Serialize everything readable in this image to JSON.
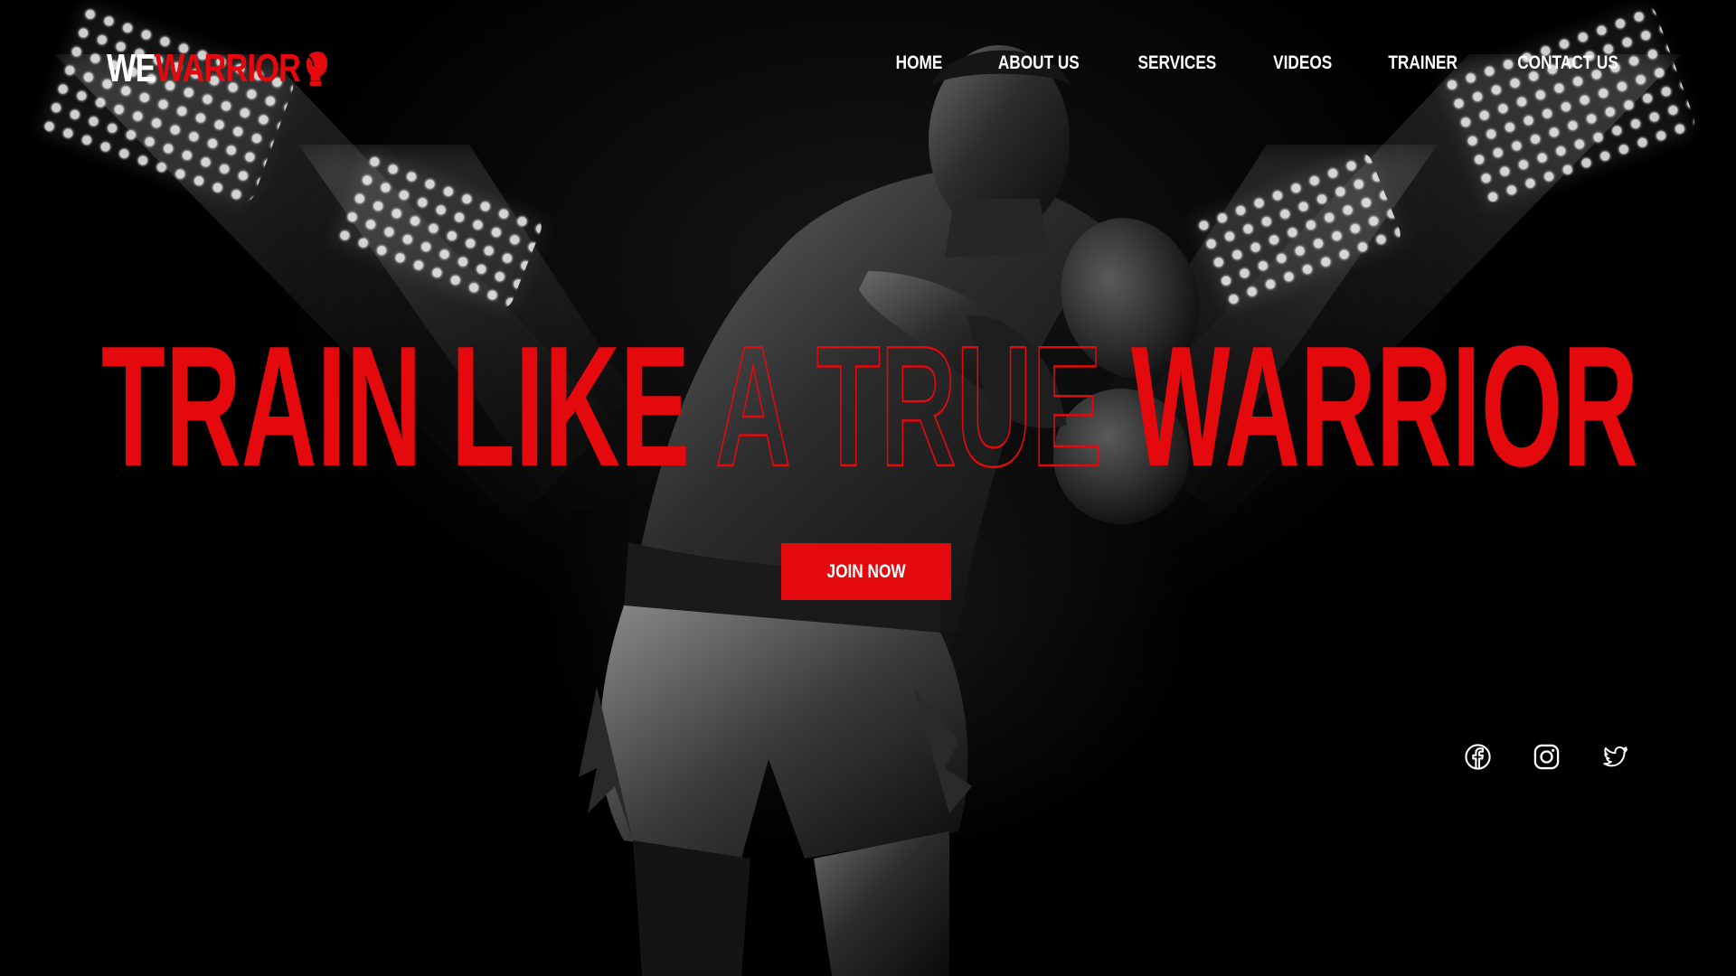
{
  "brand": {
    "logo_prefix": "WE",
    "logo_suffix": "WARRIOR",
    "logo_icon": "boxing-glove-icon",
    "accent_color": "#e3090c"
  },
  "nav": {
    "items": [
      {
        "label": "HOME"
      },
      {
        "label": "ABOUT US"
      },
      {
        "label": "SERVICES"
      },
      {
        "label": "VIDEOS"
      },
      {
        "label": "TRAINER"
      },
      {
        "label": "CONTACT US"
      }
    ]
  },
  "hero": {
    "headline_solid_1": "TRAIN LIKE",
    "headline_outline": "A TRUE",
    "headline_solid_2": "WARRIOR",
    "cta_label": "JOIN NOW"
  },
  "social": {
    "icons": [
      "facebook-icon",
      "instagram-icon",
      "twitter-icon"
    ]
  }
}
